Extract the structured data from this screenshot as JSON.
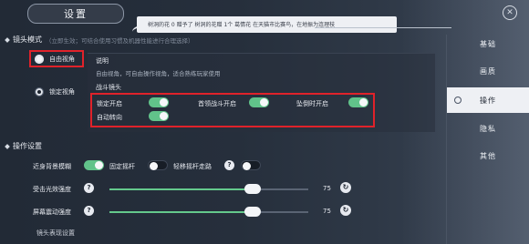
{
  "header": {
    "title": "设置",
    "banner": "树洞的花 0  赠予了  树洞的花赠 1个 葛情花    在天猫市比赛鸟，在地振为连理枝"
  },
  "camera": {
    "section_title": "镜头模式",
    "hint": "（立即生效；可结合使用习惯及机器性能进行合理选择）",
    "free_view": "自由视角",
    "locked_view": "锁定视角",
    "desc_title": "说明",
    "desc_text": "自由视角，可自由操作视角，适合熟练玩家使用",
    "combat_title": "战斗镜头",
    "options": {
      "lock_on": "锁定开启",
      "boss_on": "首领战斗开启",
      "fall_on": "坠倒时开启",
      "auto_turn": "自动转向"
    }
  },
  "controls": {
    "section_title": "操作设置",
    "near_blur": "近身背景模糊",
    "fixed_stick": "固定摇杆",
    "light_stick": "轻移摇杆走路",
    "help_glyph": "?",
    "sliders": [
      {
        "label": "受击光效强度",
        "value": "75",
        "level": 0.72
      },
      {
        "label": "屏幕震动强度",
        "value": "75",
        "level": 0.72
      }
    ],
    "lens_label": "镜头表现设置",
    "reset_glyph": "↻"
  },
  "tabs": [
    "基础",
    "画质",
    "操作",
    "隐私",
    "其他"
  ],
  "active_tab": "操作",
  "close_glyph": "✕",
  "colors": {
    "toggle_on": "#61c38a",
    "highlight": "#e0222a",
    "accent": "#64c98c"
  }
}
